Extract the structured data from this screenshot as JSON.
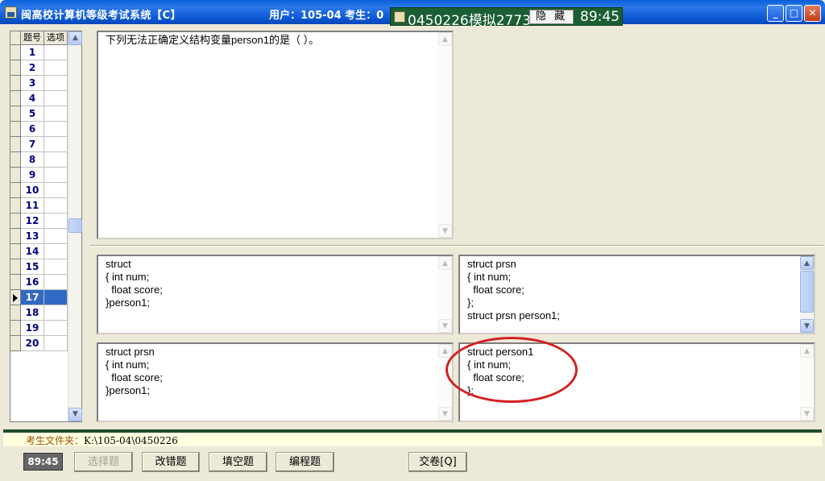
{
  "window": {
    "title": "闽高校计算机等级考试系统【C】",
    "user_info": "用户：105-04  考生：0",
    "controls": [
      "minimize",
      "maximize",
      "close"
    ]
  },
  "popup": {
    "code": "0450226模拟2773",
    "hide_label": "隐 藏",
    "time": "89:45"
  },
  "grid": {
    "col_num": "题号",
    "col_opt": "选项",
    "rows": [
      "1",
      "2",
      "3",
      "4",
      "5",
      "6",
      "7",
      "8",
      "9",
      "10",
      "11",
      "12",
      "13",
      "14",
      "15",
      "16",
      "17",
      "18",
      "19",
      "20"
    ],
    "active_row": "17"
  },
  "question": {
    "text": "下列无法正确定义结构变量person1的是（ ）。"
  },
  "options": {
    "a": "struct\n{ int num;\n  float score;\n}person1;",
    "b": "struct prsn\n{ int num;\n  float score;\n};\nstruct prsn person1;",
    "c": "struct prsn\n{ int num;\n  float score;\n}person1;",
    "d": "struct person1\n{ int num;\n  float score;\n};"
  },
  "status": {
    "path_label": "考生文件夹：",
    "path_value": "K:\\105-04\\0450226"
  },
  "footer": {
    "timer": "89:45",
    "btn_choice": "选择题",
    "btn_fix": "改错题",
    "btn_fill": "填空题",
    "btn_prog": "编程题",
    "btn_submit": "交卷[Q]"
  },
  "colors": {
    "titlebar": "#0a5fd8",
    "popup_bg": "#1b5e34",
    "highlight": "#d42020",
    "selected_row": "#316ac5"
  }
}
